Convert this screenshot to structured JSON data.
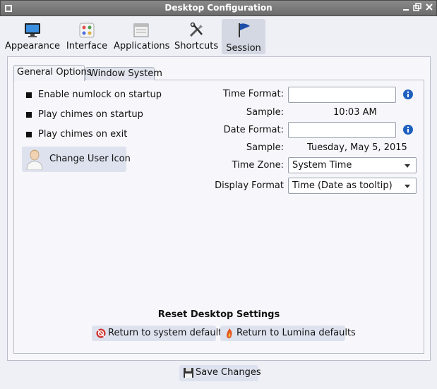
{
  "window": {
    "title": "Desktop Configuration"
  },
  "toolbar": {
    "items": [
      {
        "label": "Appearance",
        "icon": "monitor-icon"
      },
      {
        "label": "Interface",
        "icon": "palette-icon"
      },
      {
        "label": "Applications",
        "icon": "window-icon"
      },
      {
        "label": "Shortcuts",
        "icon": "tools-icon"
      },
      {
        "label": "Session",
        "icon": "flag-icon",
        "active": true
      }
    ]
  },
  "tabs": [
    {
      "label": "General Options",
      "active": true
    },
    {
      "label": "Window System",
      "active": false
    }
  ],
  "general": {
    "options": [
      {
        "label": "Enable numlock on startup"
      },
      {
        "label": "Play chimes on startup"
      },
      {
        "label": "Play chimes on exit"
      }
    ],
    "change_user_icon_label": "Change User Icon",
    "time_format_label": "Time Format:",
    "time_format_value": "",
    "time_sample_label": "Sample:",
    "time_sample_value": "10:03 AM",
    "date_format_label": "Date Format:",
    "date_format_value": "",
    "date_sample_label": "Sample:",
    "date_sample_value": "Tuesday, May 5, 2015",
    "time_zone_label": "Time Zone:",
    "time_zone_value": "System Time",
    "display_format_label": "Display Format",
    "display_format_value": "Time (Date as tooltip)"
  },
  "reset": {
    "title": "Reset Desktop Settings",
    "system_defaults_label": "Return to system defaults",
    "lumina_defaults_label": "Return to Lumina defaults"
  },
  "footer": {
    "save_label": "Save Changes"
  },
  "colors": {
    "titlebar": "#7a7a7a",
    "accent": "#1f5fbf",
    "button_bg": "#dde2ee"
  }
}
